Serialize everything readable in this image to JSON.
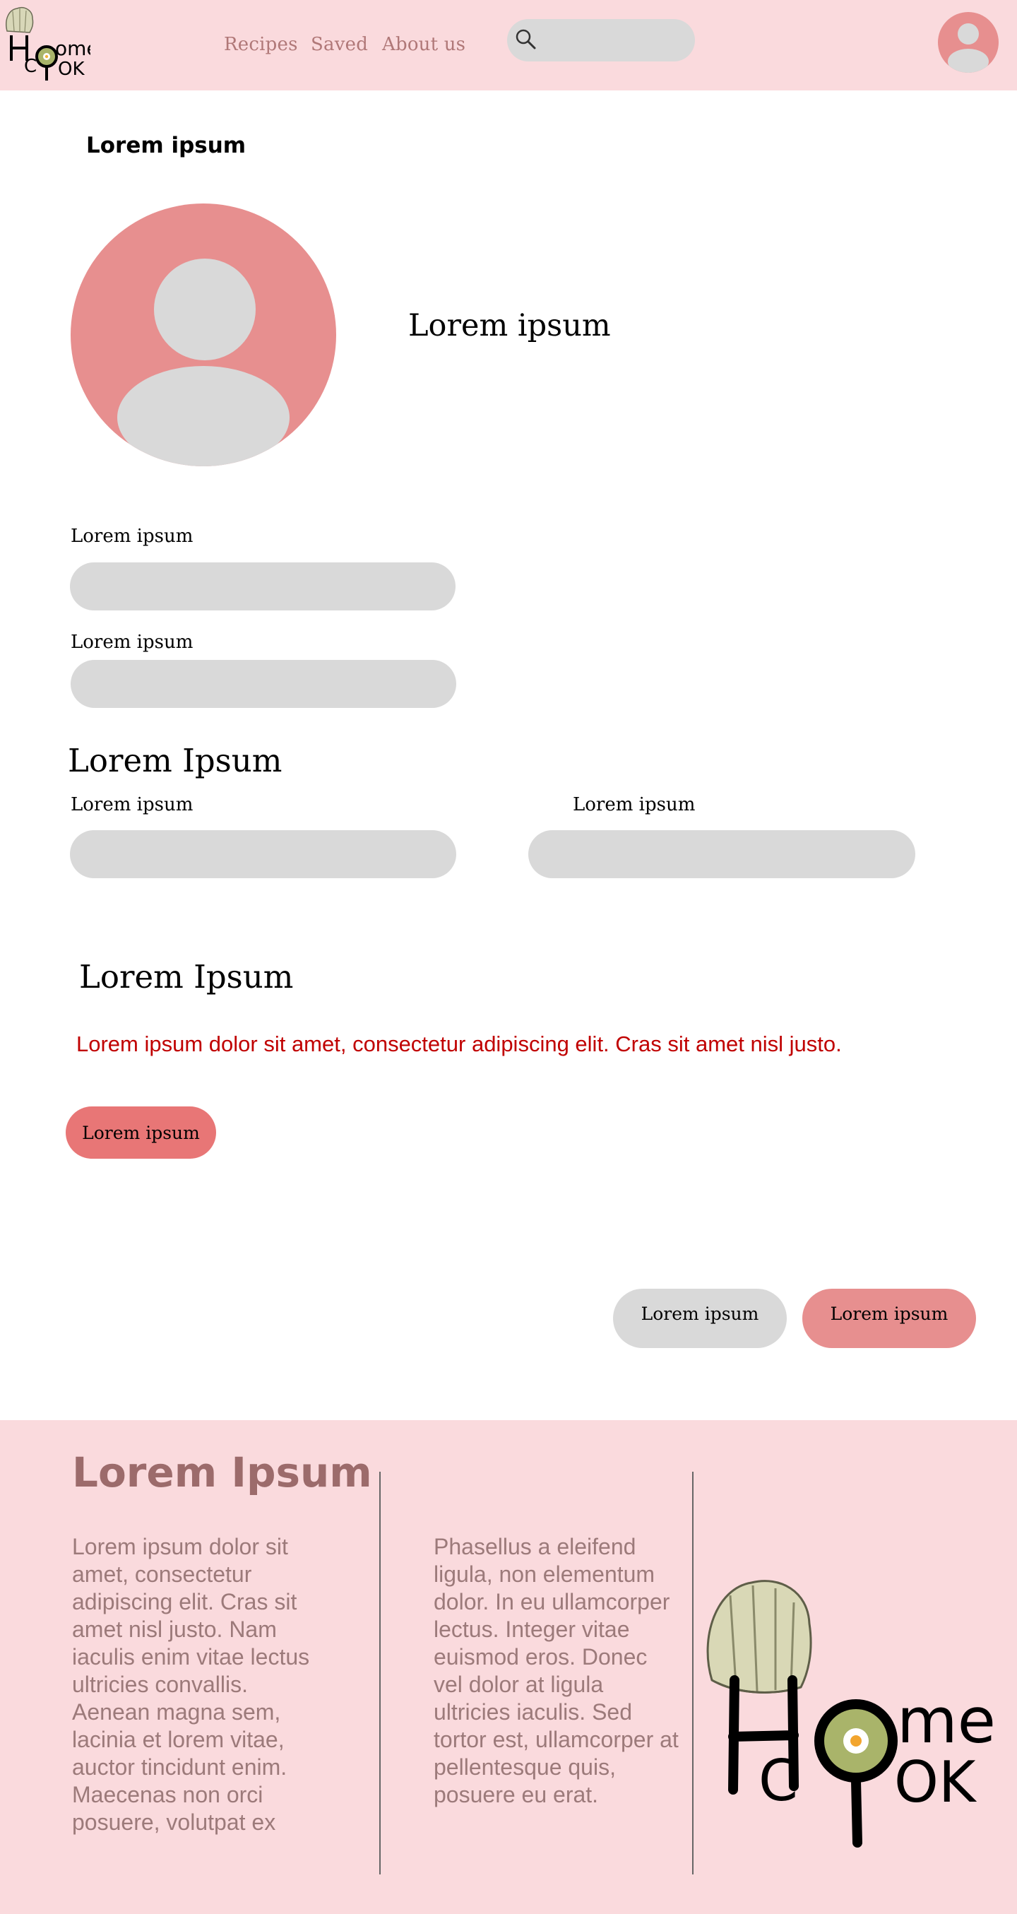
{
  "header": {
    "logo": {
      "top": "ome",
      "bottom": "C  OK",
      "letter": "H"
    },
    "nav": [
      "Recipes",
      "Saved",
      "About us"
    ],
    "search": {
      "placeholder": ""
    }
  },
  "profile": {
    "page_title": "Lorem ipsum",
    "name": "Lorem ipsum",
    "field1_label": "Lorem ipsum",
    "field2_label": "Lorem ipsum"
  },
  "section2": {
    "title": "Lorem Ipsum",
    "left_label": "Lorem ipsum",
    "right_label": "Lorem ipsum"
  },
  "section3": {
    "title": "Lorem Ipsum",
    "warning": "Lorem ipsum dolor sit amet, consectetur adipiscing elit. Cras sit amet nisl justo.",
    "button": "Lorem ipsum"
  },
  "actions": {
    "cancel": "Lorem ipsum",
    "confirm": "Lorem ipsum"
  },
  "footer": {
    "title": "Lorem Ipsum",
    "col1": "Lorem ipsum dolor sit amet, consectetur adipiscing elit. Cras sit amet nisl justo. Nam iaculis enim vitae lectus ultricies convallis. Aenean magna sem, lacinia et lorem vitae, auctor tincidunt enim. Maecenas non orci posuere, volutpat ex",
    "col2": "Phasellus a eleifend ligula, non elementum dolor. In eu ullamcorper lectus. Integer vitae euismod eros. Donec vel dolor at ligula ultricies iaculis. Sed tortor est, ullamcorper at pellentesque quis, posuere eu erat."
  },
  "colors": {
    "header_bg": "#fadadd",
    "avatar": "#e78f8f",
    "field": "#d9d9d9",
    "warning": "#c00000",
    "button_red": "#e87676",
    "footer_text": "#9c7a7a"
  },
  "icons": [
    "chef-hat-logo",
    "search-icon",
    "user-avatar-icon"
  ]
}
